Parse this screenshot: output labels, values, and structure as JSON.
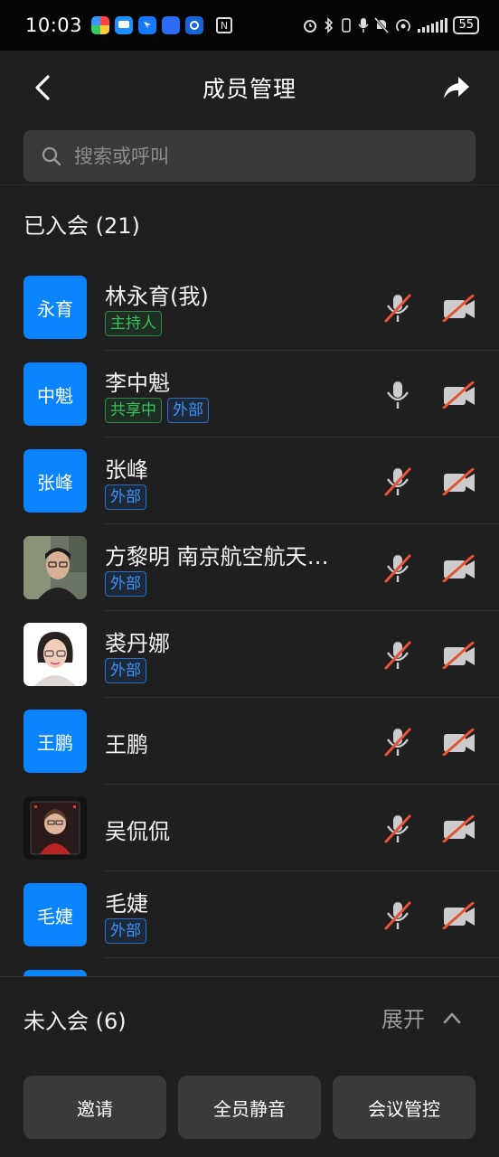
{
  "status_bar": {
    "time": "10:03",
    "battery": "55",
    "nfc": "N"
  },
  "header": {
    "title": "成员管理"
  },
  "search": {
    "placeholder": "搜索或呼叫"
  },
  "joined_section": {
    "label": "已入会 (21)"
  },
  "members": [
    {
      "avatar_text": "永育",
      "name": "林永育(我)",
      "tags": [
        {
          "text": "主持人",
          "color": "green"
        }
      ],
      "mic": "muted",
      "camera": "off"
    },
    {
      "avatar_text": "中魁",
      "name": "李中魁",
      "tags": [
        {
          "text": "共享中",
          "color": "green"
        },
        {
          "text": "外部",
          "color": "blue"
        }
      ],
      "mic": "on",
      "camera": "off"
    },
    {
      "avatar_text": "张峰",
      "name": "张峰",
      "tags": [
        {
          "text": "外部",
          "color": "blue"
        }
      ],
      "mic": "muted",
      "camera": "off"
    },
    {
      "avatar_text": "",
      "avatar_photo": "man-glasses-photo",
      "name": "方黎明 南京航空航天…",
      "tags": [
        {
          "text": "外部",
          "color": "blue"
        }
      ],
      "mic": "muted",
      "camera": "off"
    },
    {
      "avatar_text": "",
      "avatar_photo": "woman-glasses-photo",
      "name": "裘丹娜",
      "tags": [
        {
          "text": "外部",
          "color": "blue"
        }
      ],
      "mic": "muted",
      "camera": "off"
    },
    {
      "avatar_text": "王鹏",
      "name": "王鹏",
      "tags": [],
      "mic": "muted",
      "camera": "off"
    },
    {
      "avatar_text": "",
      "avatar_photo": "selfie-photo",
      "name": "吴侃侃",
      "tags": [],
      "mic": "muted",
      "camera": "off"
    },
    {
      "avatar_text": "毛婕",
      "name": "毛婕",
      "tags": [
        {
          "text": "外部",
          "color": "blue"
        }
      ],
      "mic": "muted",
      "camera": "off"
    }
  ],
  "not_joined_section": {
    "label": "未入会 (6)",
    "expand_label": "展开"
  },
  "actions": {
    "invite": "邀请",
    "mute_all": "全员静音",
    "meeting_control": "会议管控"
  },
  "colors": {
    "accent": "#0a84ff",
    "muted_slash": "#e8543a",
    "tag_green": "#33c35a",
    "tag_blue": "#3a93ff"
  }
}
